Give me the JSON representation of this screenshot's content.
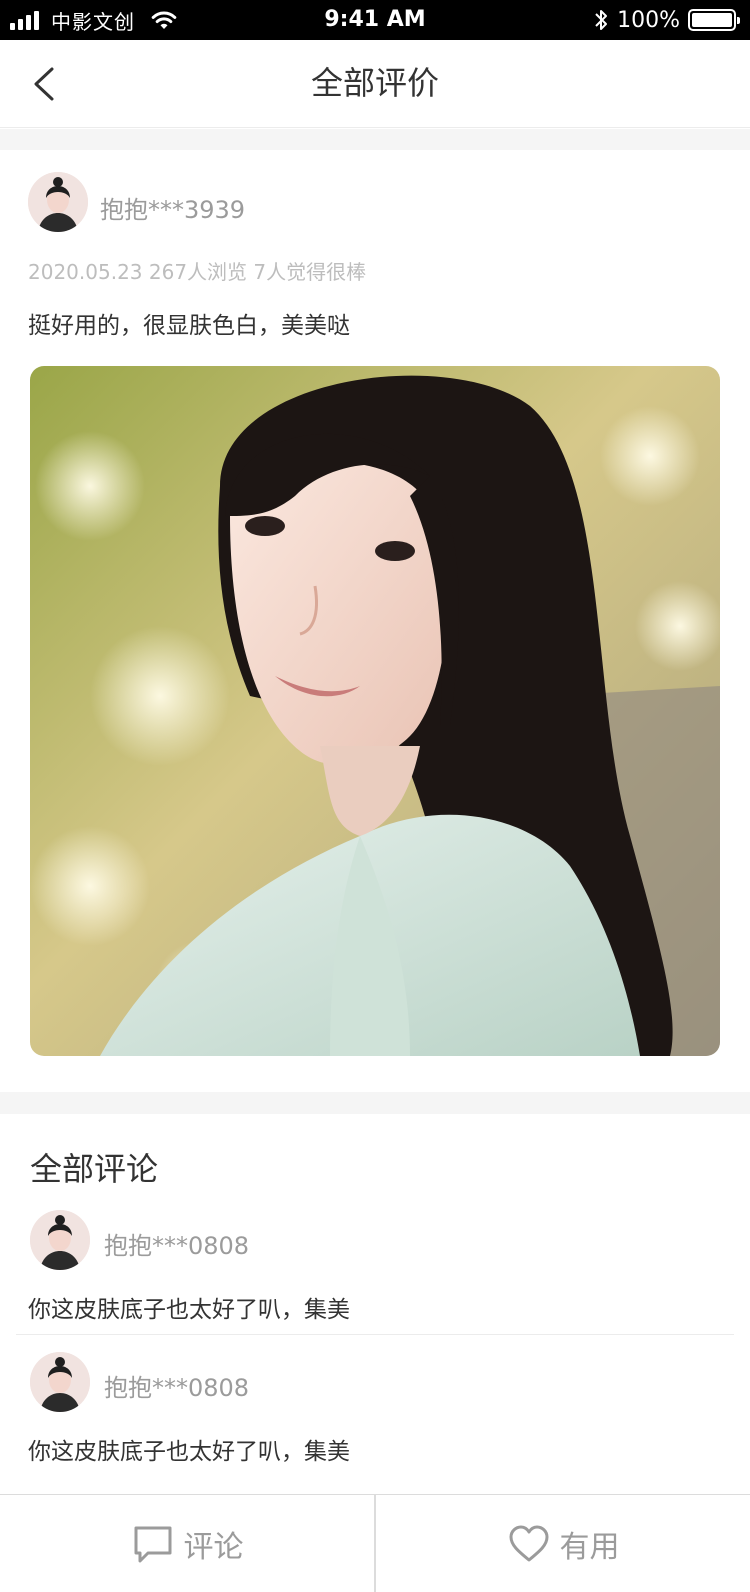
{
  "status_bar": {
    "carrier": "中影文创",
    "time": "9:41 AM",
    "battery": "100%"
  },
  "nav": {
    "title": "全部评价",
    "back_icon": "chevron-left-icon"
  },
  "review": {
    "username": "抱抱***3939",
    "meta": "2020.05.23 267人浏览 7人觉得很棒",
    "text": "挺好用的，很显肤色白，美美哒"
  },
  "comments": {
    "title": "全部评论",
    "items": [
      {
        "username": "抱抱***0808",
        "text": "你这皮肤底子也太好了叭，集美"
      },
      {
        "username": "抱抱***0808",
        "text": "你这皮肤底子也太好了叭，集美"
      }
    ]
  },
  "bottom_bar": {
    "comment_label": "评论",
    "useful_label": "有用",
    "comment_icon": "chat-bubble-icon",
    "useful_icon": "heart-icon"
  },
  "colors": {
    "text_primary": "#333333",
    "text_secondary": "#9b9b9b",
    "text_muted": "#bdbdbd",
    "band": "#f5f5f5"
  }
}
